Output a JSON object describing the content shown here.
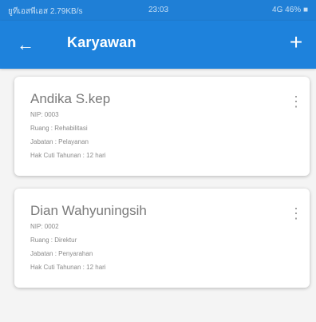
{
  "status_bar": {
    "left": "ยูทีเอสพีเอส 2.79KB/s ",
    "time": "23:03",
    "right": "4G 46% ■"
  },
  "app_bar": {
    "title": "Karyawan",
    "back_icon": "←",
    "add_icon": "+"
  },
  "cards": [
    {
      "name": "Andika S.kep",
      "nip": "NIP: 0003",
      "ruang": "Ruang : Rehabilitasi",
      "jabatan": "Jabatan : Pelayanan",
      "hak_cuti": "Hak Cuti Tahunan : 12 hari",
      "more_icon": "⋮"
    },
    {
      "name": "Dian  Wahyuningsih",
      "nip": "NIP: 0002",
      "ruang": "Ruang : Direktur",
      "jabatan": "Jabatan : Penyarahan",
      "hak_cuti": "Hak Cuti Tahunan : 12 hari",
      "more_icon": "⋮"
    }
  ],
  "colors": {
    "primary": "#1e82dc",
    "background": "#f4f4f4",
    "card": "#ffffff"
  }
}
